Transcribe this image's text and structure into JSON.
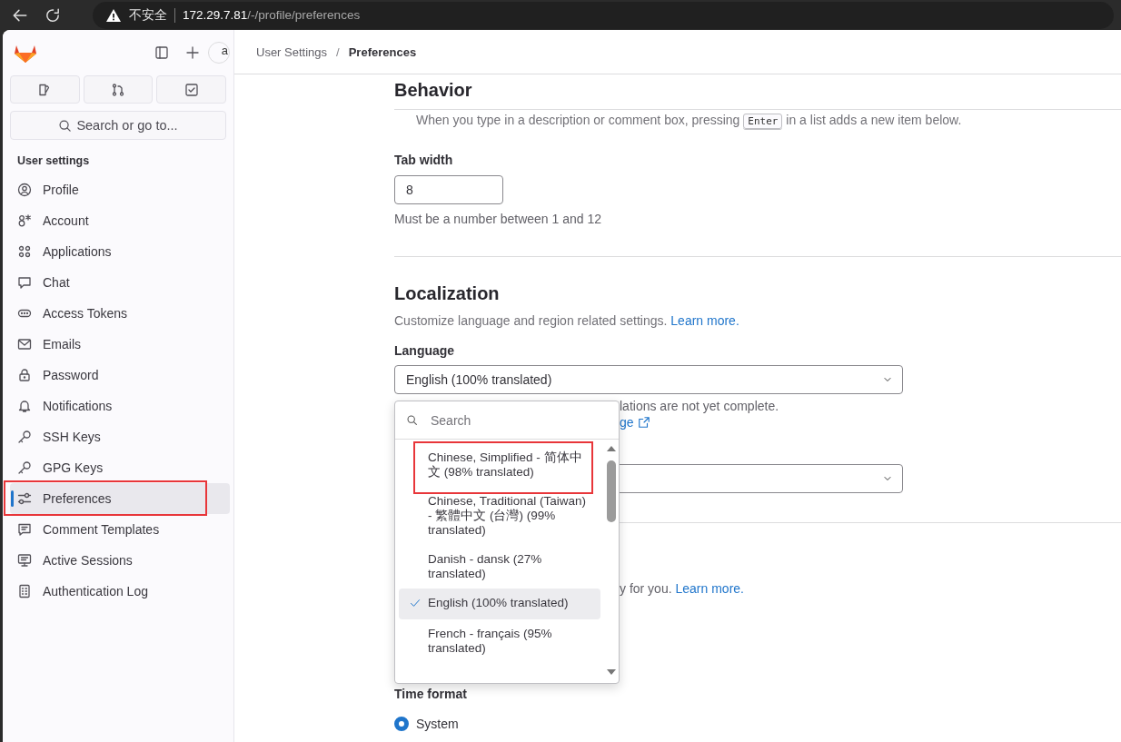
{
  "browser": {
    "security_label": "不安全",
    "url_host": "172.29.7.81",
    "url_path": "/-/profile/preferences"
  },
  "sidebar": {
    "avatar_alt": "a",
    "search": {
      "placeholder": "Search or go to..."
    },
    "section_title": "User settings",
    "items": [
      {
        "label": "Profile",
        "selected": false,
        "annotated": false
      },
      {
        "label": "Account",
        "selected": false,
        "annotated": false
      },
      {
        "label": "Applications",
        "selected": false,
        "annotated": false
      },
      {
        "label": "Chat",
        "selected": false,
        "annotated": false
      },
      {
        "label": "Access Tokens",
        "selected": false,
        "annotated": false
      },
      {
        "label": "Emails",
        "selected": false,
        "annotated": false
      },
      {
        "label": "Password",
        "selected": false,
        "annotated": false
      },
      {
        "label": "Notifications",
        "selected": false,
        "annotated": false
      },
      {
        "label": "SSH Keys",
        "selected": false,
        "annotated": false
      },
      {
        "label": "GPG Keys",
        "selected": false,
        "annotated": false
      },
      {
        "label": "Preferences",
        "selected": true,
        "annotated": true
      },
      {
        "label": "Comment Templates",
        "selected": false,
        "annotated": false
      },
      {
        "label": "Active Sessions",
        "selected": false,
        "annotated": false
      },
      {
        "label": "Authentication Log",
        "selected": false,
        "annotated": false
      }
    ]
  },
  "breadcrumbs": {
    "separator": "/",
    "items": [
      {
        "label": "User Settings",
        "current": false
      },
      {
        "label": "Preferences",
        "current": true
      }
    ]
  },
  "behavior": {
    "title": "Behavior",
    "description_before": "When you type in a description or comment box, pressing",
    "key": "Enter",
    "description_after": "in a list adds a new item below.",
    "tab_width_label": "Tab width",
    "tab_width_value": "8",
    "tab_width_help": "Must be a number between 1 and 12"
  },
  "localization": {
    "title": "Localization",
    "description": "Customize language and region related settings.",
    "learn_more": "Learn more.",
    "language_label": "Language",
    "language_value": "English (100% translated)",
    "help_fragment": "lations are not yet complete.",
    "link_fragment": "ge",
    "section_fragment": "y for you.",
    "section_link": "Learn more.",
    "time_format_label": "Time format",
    "time_format_options": [
      {
        "label": "System",
        "selected": true
      }
    ]
  },
  "language_dropdown": {
    "search": {
      "placeholder": "Search"
    },
    "options": [
      {
        "label": "Chinese, Simplified - 简体中文 (98% translated)",
        "selected": false,
        "annotated": true
      },
      {
        "label": "Chinese, Traditional (Taiwan) - 繁體中文 (台灣) (99% translated)",
        "selected": false,
        "annotated": false
      },
      {
        "label": "Danish - dansk (27% translated)",
        "selected": false,
        "annotated": false
      },
      {
        "label": "English (100% translated)",
        "selected": true,
        "annotated": false
      },
      {
        "label": "French - français (95% translated)",
        "selected": false,
        "annotated": false
      }
    ]
  }
}
